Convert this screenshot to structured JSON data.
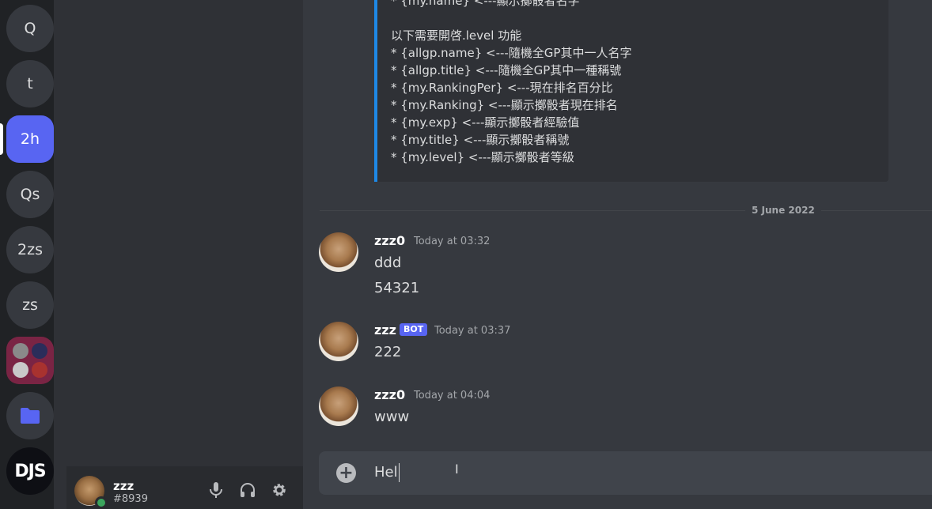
{
  "servers": [
    {
      "label": "Q"
    },
    {
      "label": "t"
    },
    {
      "label": "2h"
    },
    {
      "label": "Qs"
    },
    {
      "label": "2zs"
    },
    {
      "label": "zs"
    },
    {
      "label": ""
    },
    {
      "label": ""
    },
    {
      "label": "DJS"
    }
  ],
  "user_panel": {
    "name": "zzz",
    "tag": "#8939"
  },
  "embed": {
    "lines": [
      "* {my.name} <---顯示擲骰者名字",
      "",
      "以下需要開啓.level 功能",
      "* {allgp.name} <---隨機全GP其中一人名字",
      "* {allgp.title} <---隨機全GP其中一種稱號",
      "* {my.RankingPer} <---現在排名百分比",
      "* {my.Ranking} <---顯示擲骰者現在排名",
      "* {my.exp} <---顯示擲骰者經驗值",
      "* {my.title} <---顯示擲骰者稱號",
      "* {my.level} <---顯示擲骰者等級"
    ],
    "accent": "#1e88e5"
  },
  "date_divider": "5 June 2022",
  "messages": [
    {
      "user": "zzz0",
      "time": "Today at 03:32",
      "lines": [
        "ddd",
        "54321"
      ]
    },
    {
      "user": "zzz",
      "badge": "BOT",
      "time": "Today at 03:37",
      "lines": [
        "222"
      ]
    },
    {
      "user": "zzz0",
      "time": "Today at 04:04",
      "lines": [
        "www"
      ]
    }
  ],
  "composer": {
    "value": "Hel"
  },
  "colors": {
    "blurple": "#5865f2",
    "online": "#3ba55d"
  }
}
